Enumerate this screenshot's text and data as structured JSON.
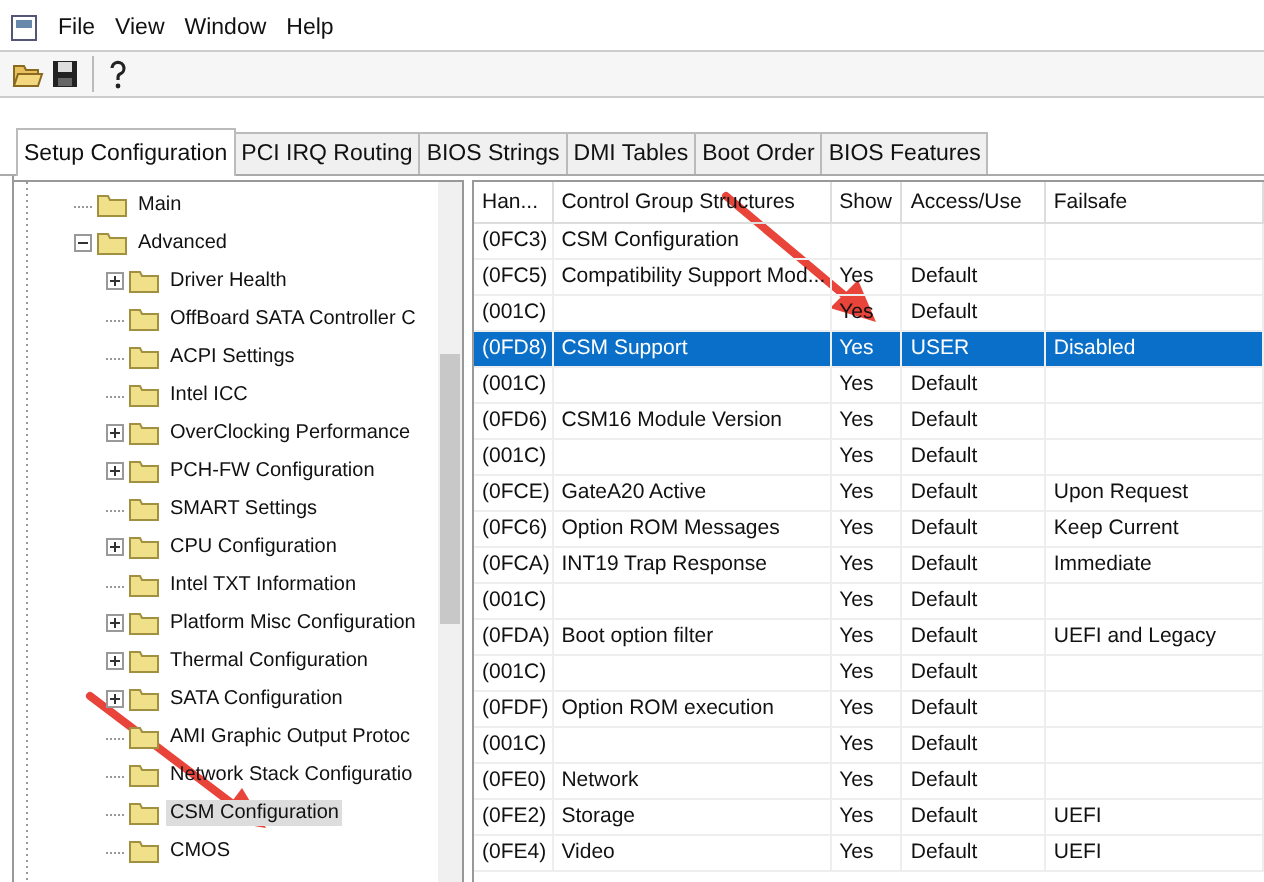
{
  "menu": [
    "File",
    "View",
    "Window",
    "Help"
  ],
  "tabs": [
    {
      "label": "Setup Configuration",
      "selected": true
    },
    {
      "label": "PCI IRQ Routing",
      "selected": false
    },
    {
      "label": "BIOS Strings",
      "selected": false
    },
    {
      "label": "DMI Tables",
      "selected": false
    },
    {
      "label": "Boot Order",
      "selected": false
    },
    {
      "label": "BIOS Features",
      "selected": false
    }
  ],
  "tree": [
    {
      "label": "Main",
      "selected": false
    },
    {
      "label": "Advanced",
      "expanded": true,
      "selected": false,
      "children": [
        {
          "label": "Driver Health",
          "expanded": false,
          "selected": false
        },
        {
          "label": "OffBoard SATA Controller C",
          "selected": false
        },
        {
          "label": "ACPI Settings",
          "selected": false
        },
        {
          "label": "Intel ICC",
          "selected": false
        },
        {
          "label": "OverClocking Performance",
          "expanded": false,
          "selected": false
        },
        {
          "label": "PCH-FW Configuration",
          "expanded": false,
          "selected": false
        },
        {
          "label": "SMART Settings",
          "selected": false
        },
        {
          "label": "CPU Configuration",
          "expanded": false,
          "selected": false
        },
        {
          "label": "Intel TXT Information",
          "selected": false
        },
        {
          "label": "Platform Misc Configuration",
          "expanded": false,
          "selected": false
        },
        {
          "label": "Thermal Configuration",
          "expanded": false,
          "selected": false
        },
        {
          "label": "SATA Configuration",
          "expanded": false,
          "selected": false
        },
        {
          "label": "AMI Graphic Output Protoc",
          "selected": false
        },
        {
          "label": "Network Stack Configuratio",
          "selected": false
        },
        {
          "label": "CSM Configuration",
          "selected": true
        },
        {
          "label": "CMOS",
          "selected": false
        }
      ]
    }
  ],
  "table": {
    "columns": [
      "Han...",
      "Control Group Structures",
      "Show",
      "Access/Use",
      "Failsafe"
    ],
    "rows": [
      {
        "cells": [
          "(0FC3)",
          "CSM Configuration",
          "",
          "",
          ""
        ],
        "selected": false
      },
      {
        "cells": [
          "(0FC5)",
          "Compatibility Support Mod...",
          "Yes",
          "Default",
          ""
        ],
        "selected": false
      },
      {
        "cells": [
          "(001C)",
          "",
          "Yes",
          "Default",
          ""
        ],
        "selected": false
      },
      {
        "cells": [
          "(0FD8)",
          "CSM Support",
          "Yes",
          "USER",
          "Disabled"
        ],
        "selected": true
      },
      {
        "cells": [
          "(001C)",
          "",
          "Yes",
          "Default",
          ""
        ],
        "selected": false
      },
      {
        "cells": [
          "(0FD6)",
          "CSM16 Module Version",
          "Yes",
          "Default",
          ""
        ],
        "selected": false
      },
      {
        "cells": [
          "(001C)",
          "",
          "Yes",
          "Default",
          ""
        ],
        "selected": false
      },
      {
        "cells": [
          "(0FCE)",
          "GateA20 Active",
          "Yes",
          "Default",
          "Upon Request"
        ],
        "selected": false
      },
      {
        "cells": [
          "(0FC6)",
          "Option ROM Messages",
          "Yes",
          "Default",
          "Keep Current"
        ],
        "selected": false
      },
      {
        "cells": [
          "(0FCA)",
          "INT19 Trap Response",
          "Yes",
          "Default",
          "Immediate"
        ],
        "selected": false
      },
      {
        "cells": [
          "(001C)",
          "",
          "Yes",
          "Default",
          ""
        ],
        "selected": false
      },
      {
        "cells": [
          "(0FDA)",
          "Boot option filter",
          "Yes",
          "Default",
          "UEFI and Legacy"
        ],
        "selected": false
      },
      {
        "cells": [
          "(001C)",
          "",
          "Yes",
          "Default",
          ""
        ],
        "selected": false
      },
      {
        "cells": [
          "(0FDF)",
          "Option ROM execution",
          "Yes",
          "Default",
          ""
        ],
        "selected": false
      },
      {
        "cells": [
          "(001C)",
          "",
          "Yes",
          "Default",
          ""
        ],
        "selected": false
      },
      {
        "cells": [
          "(0FE0)",
          "Network",
          "Yes",
          "Default",
          ""
        ],
        "selected": false
      },
      {
        "cells": [
          "(0FE2)",
          "Storage",
          "Yes",
          "Default",
          "UEFI"
        ],
        "selected": false
      },
      {
        "cells": [
          "(0FE4)",
          "Video",
          "Yes",
          "Default",
          "UEFI"
        ],
        "selected": false
      }
    ]
  }
}
